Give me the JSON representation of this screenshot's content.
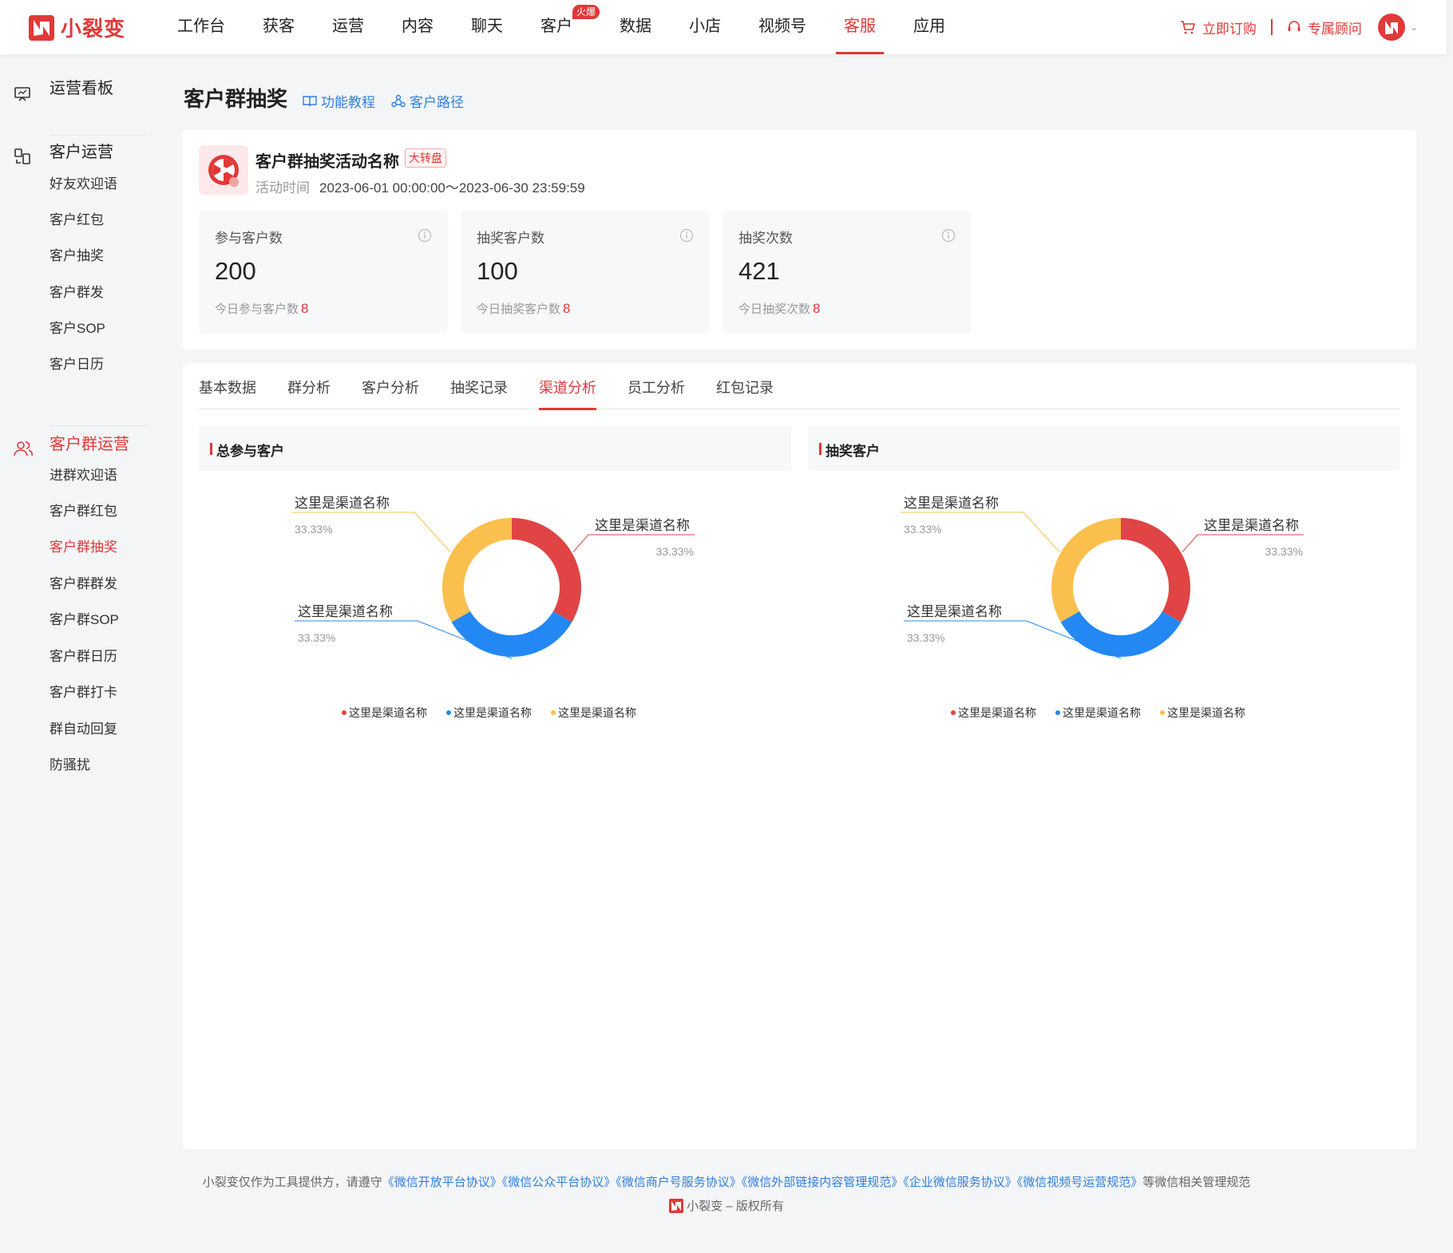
{
  "brand": {
    "name": "小裂变",
    "color": "#e23838"
  },
  "nav": {
    "items": [
      {
        "label": "工作台"
      },
      {
        "label": "获客"
      },
      {
        "label": "运营"
      },
      {
        "label": "内容"
      },
      {
        "label": "聊天"
      },
      {
        "label": "客户",
        "badge": "火爆"
      },
      {
        "label": "数据"
      },
      {
        "label": "小店"
      },
      {
        "label": "视频号"
      },
      {
        "label": "客服",
        "active": true
      },
      {
        "label": "应用"
      }
    ],
    "buy_label": "立即订购",
    "consultant_label": "专属顾问"
  },
  "sidebar": {
    "dashboard_label": "运营看板",
    "customer_ops": {
      "label": "客户运营",
      "items": [
        "好友欢迎语",
        "客户红包",
        "客户抽奖",
        "客户群发",
        "客户SOP",
        "客户日历"
      ]
    },
    "group_ops": {
      "label": "客户群运营",
      "items": [
        "进群欢迎语",
        "客户群红包",
        "客户群抽奖",
        "客户群群发",
        "客户群SOP",
        "客户群日历",
        "客户群打卡",
        "群自动回复",
        "防骚扰"
      ],
      "active_item": "客户群抽奖"
    }
  },
  "page": {
    "title": "客户群抽奖",
    "tutorial_label": "功能教程",
    "path_label": "客户路径"
  },
  "activity": {
    "name": "客户群抽奖活动名称",
    "tag": "大转盘",
    "time_label": "活动时间",
    "time": "2023-06-01 00:00:00～2023-06-30 23:59:59"
  },
  "stats": [
    {
      "label": "参与客户数",
      "value": "200",
      "sub_label": "今日参与客户数",
      "sub_value": "8"
    },
    {
      "label": "抽奖客户数",
      "value": "100",
      "sub_label": "今日抽奖客户数",
      "sub_value": "8"
    },
    {
      "label": "抽奖次数",
      "value": "421",
      "sub_label": "今日抽奖次数",
      "sub_value": "8"
    }
  ],
  "tabs": [
    "基本数据",
    "群分析",
    "客户分析",
    "抽奖记录",
    "渠道分析",
    "员工分析",
    "红包记录"
  ],
  "active_tab": "渠道分析",
  "chart_data": [
    {
      "type": "pie",
      "title": "总参与客户",
      "categories": [
        "这里是渠道名称",
        "这里是渠道名称",
        "这里是渠道名称"
      ],
      "values": [
        33.33,
        33.33,
        33.33
      ],
      "labels": [
        "33.33%",
        "33.33%",
        "33.33%"
      ],
      "colors": [
        "#e04444",
        "#2388f4",
        "#fbbf4d"
      ],
      "legend": "bottom"
    },
    {
      "type": "pie",
      "title": "抽奖客户",
      "categories": [
        "这里是渠道名称",
        "这里是渠道名称",
        "这里是渠道名称"
      ],
      "values": [
        33.33,
        33.33,
        33.33
      ],
      "labels": [
        "33.33%",
        "33.33%",
        "33.33%"
      ],
      "colors": [
        "#e04444",
        "#2388f4",
        "#fbbf4d"
      ],
      "legend": "bottom"
    }
  ],
  "footer": {
    "prefix": "小裂变仅作为工具提供方，请遵守",
    "links": [
      "《微信开放平台协议》",
      "《微信公众平台协议》",
      "《微信商户号服务协议》",
      "《微信外部链接内容管理规范》",
      "《企业微信服务协议》",
      "《微信视频号运营规范》"
    ],
    "suffix": "等微信相关管理规范",
    "copyright": "小裂变 – 版权所有"
  }
}
